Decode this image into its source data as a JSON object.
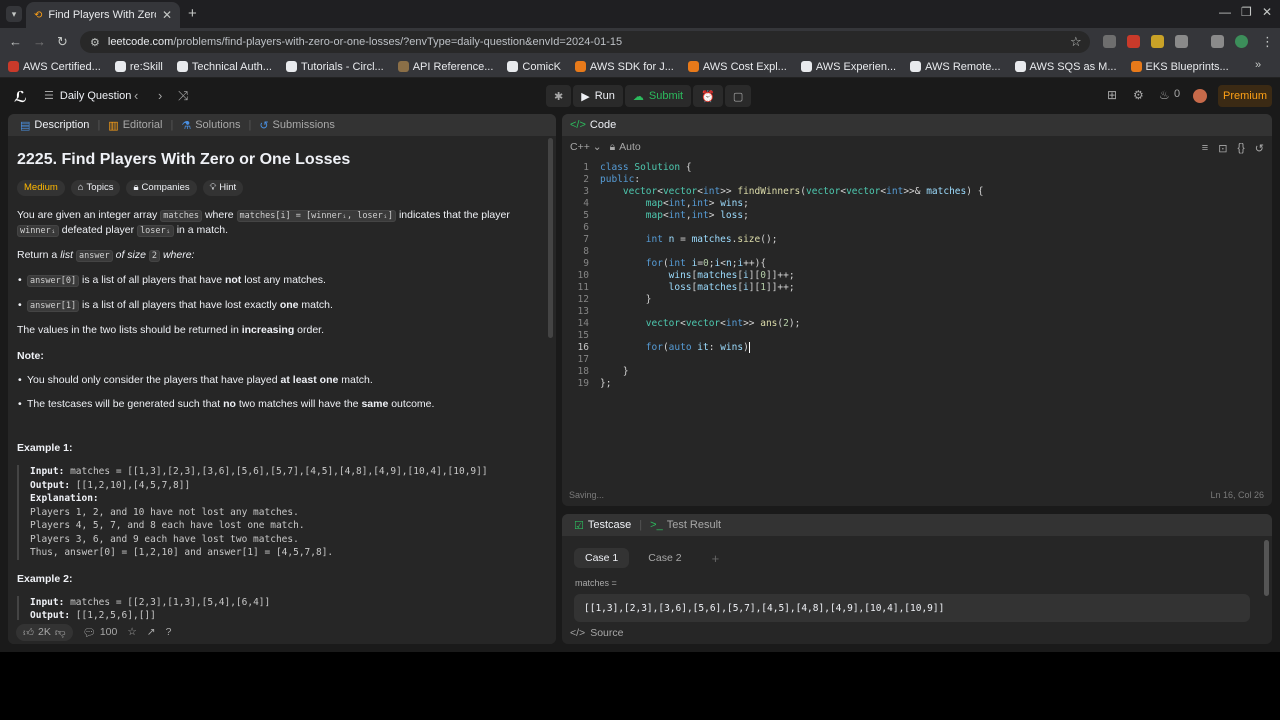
{
  "browser": {
    "tab_title": "Find Players With Zero or One Losses - LeetCode",
    "url_host": "leetcode.com",
    "url_path": "/problems/find-players-with-zero-or-one-losses/?envType=daily-question&envId=2024-01-15",
    "bookmarks": [
      {
        "label": "AWS Certified...",
        "color": "#c93a2a"
      },
      {
        "label": "re:Skill",
        "color": "#e8eaed"
      },
      {
        "label": "Technical Auth...",
        "color": "#e8eaed"
      },
      {
        "label": "Tutorials - Circl...",
        "color": "#e8eaed"
      },
      {
        "label": "API Reference...",
        "color": "#8b6f47"
      },
      {
        "label": "ComicK",
        "color": "#e8eaed"
      },
      {
        "label": "AWS SDK for J...",
        "color": "#e87a1a"
      },
      {
        "label": "AWS Cost Expl...",
        "color": "#e87a1a"
      },
      {
        "label": "AWS Experien...",
        "color": "#e8eaed"
      },
      {
        "label": "AWS Remote...",
        "color": "#e8eaed"
      },
      {
        "label": "AWS SQS as M...",
        "color": "#e8eaed"
      },
      {
        "label": "EKS Blueprints...",
        "color": "#e87a1a"
      }
    ]
  },
  "toolbar": {
    "list_label": "Daily Question",
    "run_label": "Run",
    "submit_label": "Submit",
    "streak_count": "0",
    "premium_label": "Premium"
  },
  "left_tabs": [
    "Description",
    "Editorial",
    "Solutions",
    "Submissions"
  ],
  "problem": {
    "title": "2225. Find Players With Zero or One Losses",
    "difficulty": "Medium",
    "chips": [
      "Topics",
      "Companies",
      "Hint"
    ],
    "p1_a": "You are given an integer array",
    "p1_code1": "matches",
    "p1_b": "where",
    "p1_code2": "matches[i] = [winnerᵢ, loserᵢ]",
    "p1_c": "indicates that the player",
    "p1_code3": "winnerᵢ",
    "p1_d": "defeated player",
    "p1_code4": "loserᵢ",
    "p1_e": "in a match.",
    "p2_a": "Return a",
    "p2_list": "list",
    "p2_code": "answer",
    "p2_b": "of size",
    "p2_size": "2",
    "p2_c": "where:",
    "b1_code": "answer[0]",
    "b1_a": "is a list of all players that have",
    "b1_bold": "not",
    "b1_b": "lost any matches.",
    "b2_code": "answer[1]",
    "b2_a": "is a list of all players that have lost exactly",
    "b2_bold": "one",
    "b2_b": "match.",
    "p3_a": "The values in the two lists should be returned in",
    "p3_bold": "increasing",
    "p3_b": "order.",
    "note_label": "Note:",
    "n1_a": "You should only consider the players that have played",
    "n1_bold": "at least one",
    "n1_b": "match.",
    "n2_a": "The testcases will be generated such that",
    "n2_bold1": "no",
    "n2_b": "two matches will have the",
    "n2_bold2": "same",
    "n2_c": "outcome.",
    "ex1_title": "Example 1:",
    "ex1_input_label": "Input:",
    "ex1_input": "matches = [[1,3],[2,3],[3,6],[5,6],[5,7],[4,5],[4,8],[4,9],[10,4],[10,9]]",
    "ex1_output_label": "Output:",
    "ex1_output": "[[1,2,10],[4,5,7,8]]",
    "ex1_expl_label": "Explanation:",
    "ex1_expl": [
      "Players 1, 2, and 10 have not lost any matches.",
      "Players 4, 5, 7, and 8 each have lost one match.",
      "Players 3, 6, and 9 each have lost two matches.",
      "Thus, answer[0] = [1,2,10] and answer[1] = [4,5,7,8]."
    ],
    "ex2_title": "Example 2:",
    "ex2_input_label": "Input:",
    "ex2_input": "matches = [[2,3],[1,3],[5,4],[6,4]]",
    "ex2_output_label": "Output:",
    "ex2_output": "[[1,2,5,6],[]]"
  },
  "footer": {
    "likes": "2K",
    "comments": "100"
  },
  "code_panel": {
    "title": "Code",
    "language": "C++",
    "mode": "Auto",
    "status": "Saving...",
    "cursor": "Ln 16, Col 26"
  },
  "test_panel": {
    "tab_testcase": "Testcase",
    "tab_result": "Test Result",
    "cases": [
      "Case 1",
      "Case 2"
    ],
    "add": "+",
    "var_label": "matches =",
    "value": "[[1,3],[2,3],[3,6],[5,6],[5,7],[4,5],[4,8],[4,9],[10,4],[10,9]]",
    "source": "Source"
  }
}
